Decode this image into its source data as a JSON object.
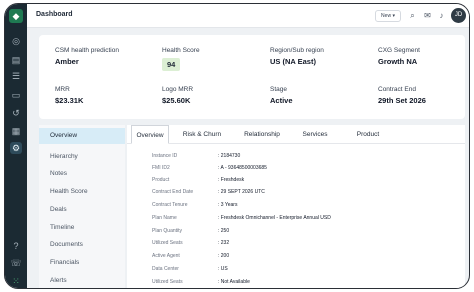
{
  "app": {
    "logo_glyph": "◆",
    "rail_icons": [
      "dashboard-icon",
      "accounts-icon",
      "list-icon",
      "inbox-icon",
      "history-icon",
      "reports-icon",
      "settings-icon",
      "help-icon",
      "phone-icon",
      "apps-grid-icon"
    ]
  },
  "topbar": {
    "title": "Dashboard",
    "new_label": "New ▾",
    "avatar_initials": "JD"
  },
  "summary": {
    "fields": [
      {
        "label": "CSM health prediction",
        "value": "Amber"
      },
      {
        "label": "Health Score",
        "value": "94"
      },
      {
        "label": "Region/Sub region",
        "value": "US (NA East)"
      },
      {
        "label": "CXG Segment",
        "value": "Growth NA"
      },
      {
        "label": "MRR",
        "value": "$23.31K"
      },
      {
        "label": "Logo MRR",
        "value": "$25.60K"
      },
      {
        "label": "Stage",
        "value": "Active"
      },
      {
        "label": "Contract End",
        "value": "29th Set 2026"
      }
    ]
  },
  "sidenav": {
    "items": [
      "Overview",
      "Hierarchy",
      "Notes",
      "Health Score",
      "Deals",
      "Timeline",
      "Documents",
      "Financials",
      "Alerts"
    ]
  },
  "tabs": [
    "Overview",
    "Risk & Churn",
    "Relationship",
    "Services",
    "Product"
  ],
  "details": [
    {
      "key": "Instance ID",
      "value": ": 2184730"
    },
    {
      "key": "FMI ID2",
      "value": ": A - 93648500003685"
    },
    {
      "key": "Product",
      "value": ": Freshdesk"
    },
    {
      "key": "Contract End Date",
      "value": ": 29 SEPT 2026 UTC"
    },
    {
      "key": "Contract Tenure",
      "value": ": 3 Years"
    },
    {
      "key": "Plan Name",
      "value": ": Freshdesk Omnichannel - Enterprise Annual USD"
    },
    {
      "key": "Plan Quantity",
      "value": ": 250"
    },
    {
      "key": "Utilized Seats",
      "value": ": 232"
    },
    {
      "key": "Active Agent",
      "value": ": 200"
    },
    {
      "key": "Data Center",
      "value": ": US"
    },
    {
      "key": "Utilized Seats",
      "value": ": Not Available"
    }
  ]
}
